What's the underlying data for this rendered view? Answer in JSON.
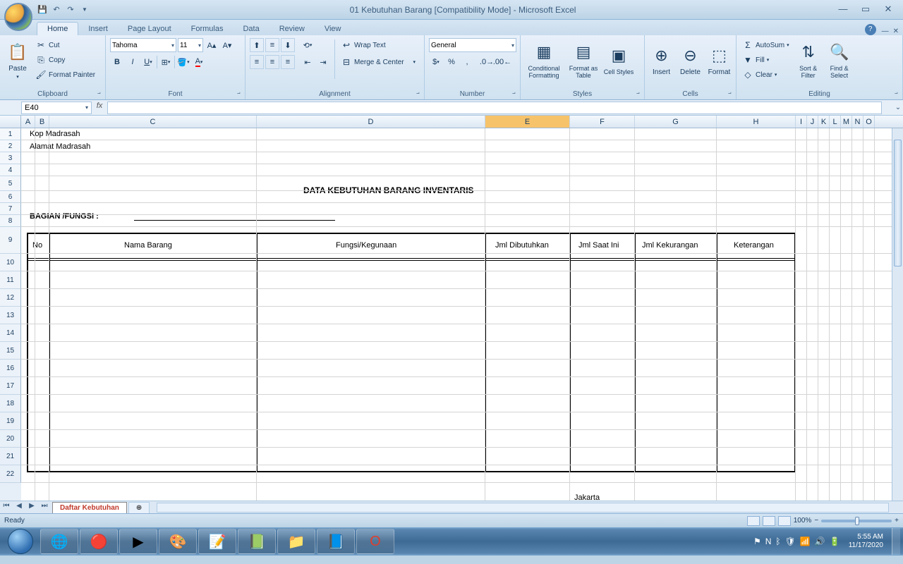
{
  "title": "01 Kebutuhan Barang  [Compatibility Mode] - Microsoft Excel",
  "tabs": {
    "home": "Home",
    "insert": "Insert",
    "pagelayout": "Page Layout",
    "formulas": "Formulas",
    "data": "Data",
    "review": "Review",
    "view": "View"
  },
  "clipboard": {
    "paste": "Paste",
    "cut": "Cut",
    "copy": "Copy",
    "fp": "Format Painter",
    "label": "Clipboard"
  },
  "font": {
    "name": "Tahoma",
    "size": "11",
    "label": "Font"
  },
  "alignment": {
    "wrap": "Wrap Text",
    "merge": "Merge & Center",
    "label": "Alignment"
  },
  "number": {
    "format": "General",
    "label": "Number"
  },
  "styles": {
    "cf": "Conditional Formatting",
    "fat": "Format as Table",
    "cs": "Cell Styles",
    "label": "Styles"
  },
  "cells": {
    "insert": "Insert",
    "delete": "Delete",
    "format": "Format",
    "label": "Cells"
  },
  "editing": {
    "sum": "AutoSum",
    "fill": "Fill",
    "clear": "Clear",
    "sort": "Sort & Filter",
    "find": "Find & Select",
    "label": "Editing"
  },
  "namebox": "E40",
  "sheet": {
    "row1": "Kop Madrasah",
    "row2": "Alamat Madrasah",
    "title": "DATA KEBUTUHAN BARANG INVENTARIS",
    "bagian": "BAGIAN /FUNGSI : ",
    "headers": {
      "no": "No",
      "nama": "Nama Barang",
      "fungsi": "Fungsi/Kegunaan",
      "jmldib": "Jml Dibutuhkan",
      "jmlsaat": "Jml Saat Ini",
      "jmlkur": "Jml Kekurangan",
      "ket": "Keterangan"
    },
    "footer": "Jakarta"
  },
  "tabs_sheet": {
    "name": "Daftar Kebutuhan"
  },
  "status": {
    "ready": "Ready",
    "zoom": "100%"
  },
  "clock": {
    "time": "5:55 AM",
    "date": "11/17/2020"
  }
}
